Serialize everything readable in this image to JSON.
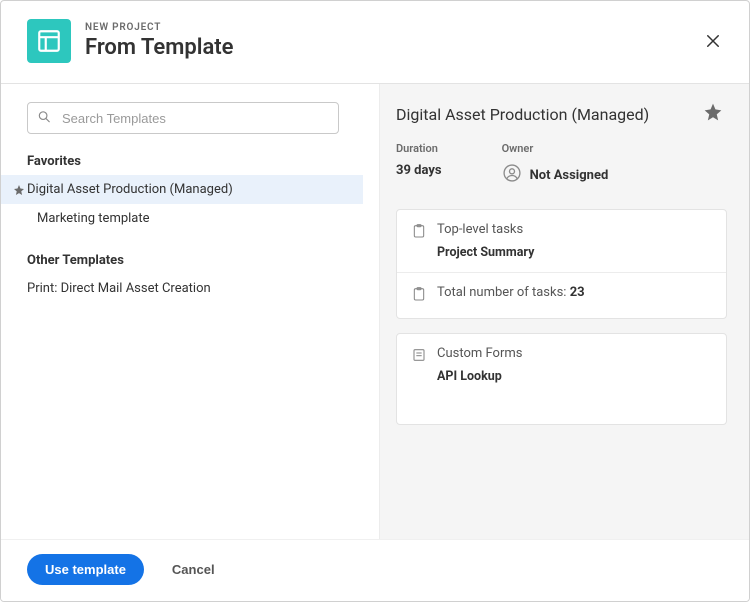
{
  "header": {
    "kicker": "NEW PROJECT",
    "title": "From Template"
  },
  "search": {
    "placeholder": "Search Templates"
  },
  "sidebar": {
    "favorites_label": "Favorites",
    "favorites": [
      {
        "label": "Digital Asset Production (Managed)",
        "starred": true,
        "selected": true
      },
      {
        "label": "Marketing template",
        "starred": false,
        "selected": false
      }
    ],
    "other_label": "Other Templates",
    "other": [
      {
        "label": "Print: Direct Mail Asset Creation"
      }
    ]
  },
  "detail": {
    "title": "Digital Asset Production (Managed)",
    "duration_label": "Duration",
    "duration_value": "39 days",
    "owner_label": "Owner",
    "owner_value": "Not Assigned",
    "top_tasks_label": "Top-level tasks",
    "top_tasks_value": "Project Summary",
    "total_tasks_label": "Total number of tasks: ",
    "total_tasks_value": "23",
    "forms_label": "Custom Forms",
    "forms_value": "API Lookup"
  },
  "footer": {
    "primary": "Use template",
    "cancel": "Cancel"
  }
}
